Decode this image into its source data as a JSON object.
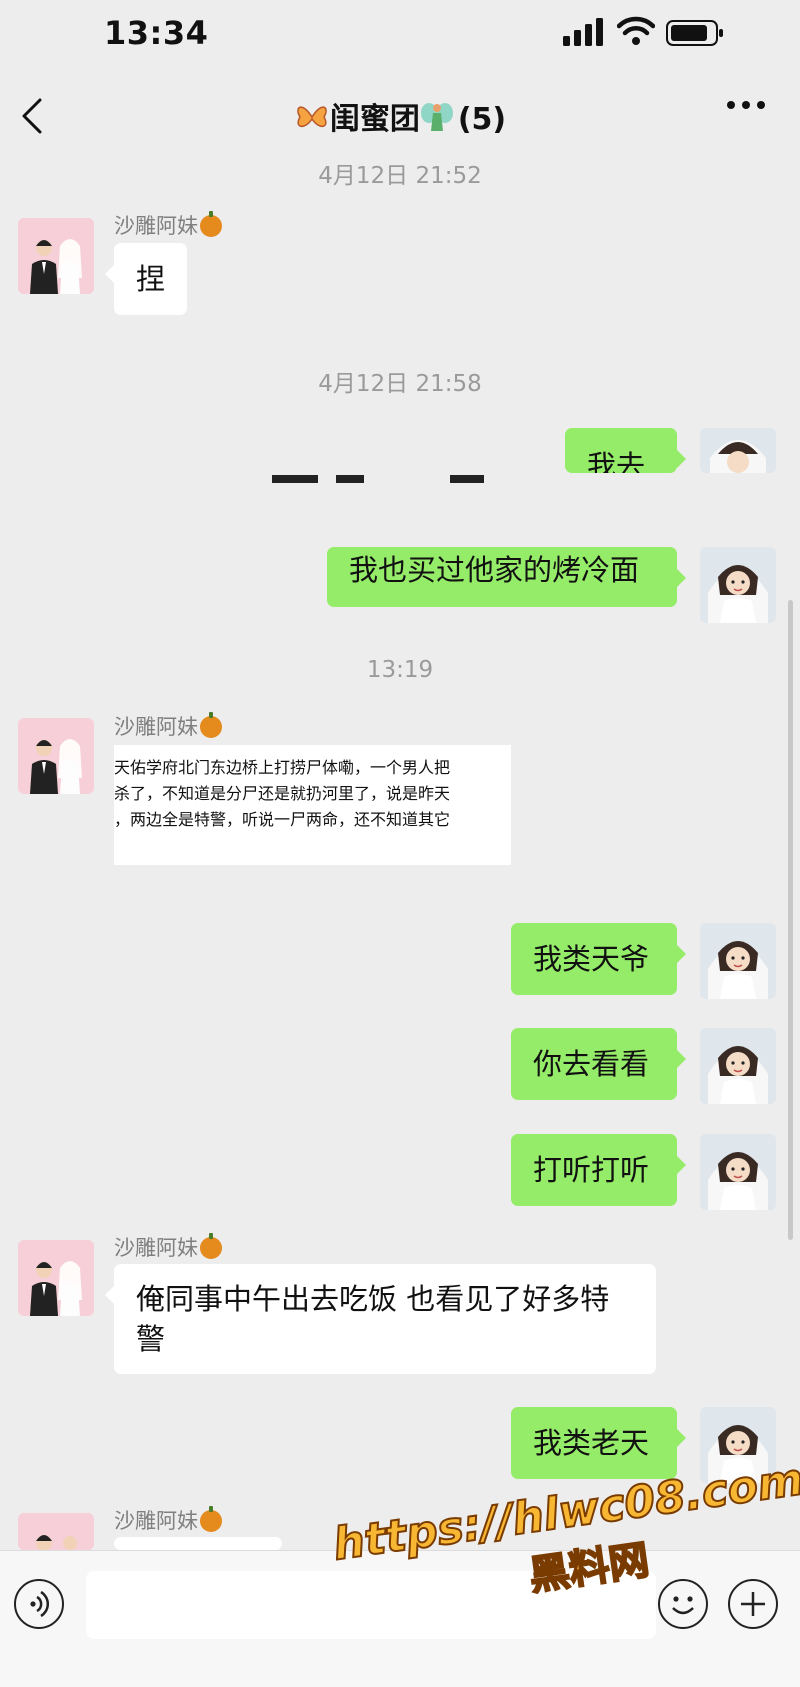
{
  "status": {
    "time": "13:34"
  },
  "header": {
    "title": "闺蜜团",
    "count": "(5)"
  },
  "timestamps": [
    "4月12日 21:52",
    "4月12日 21:58",
    "13:19"
  ],
  "sender": {
    "name": "沙雕阿妹"
  },
  "messages": {
    "m1": "捏",
    "m2": "我去",
    "m3": "我也买过他家的烤冷面",
    "m4_image_lines": [
      "天佑学府北门东边桥上打捞尸体嘞，一个男人把",
      "杀了，不知道是分尸还是就扔河里了，说是昨天",
      "，两边全是特警，听说一尸两命，还不知道其它"
    ],
    "m5": "我类天爷",
    "m6": "你去看看",
    "m7": "打听打听",
    "m8": "俺同事中午出去吃饭 也看见了好多特警",
    "m9": "我类老天"
  },
  "watermark": {
    "line1": "https://hlwc08.com",
    "line2": "黑料网"
  },
  "icons": [
    "back-chevron-icon",
    "more-dots-icon",
    "voice-icon",
    "emoji-icon",
    "plus-icon"
  ]
}
